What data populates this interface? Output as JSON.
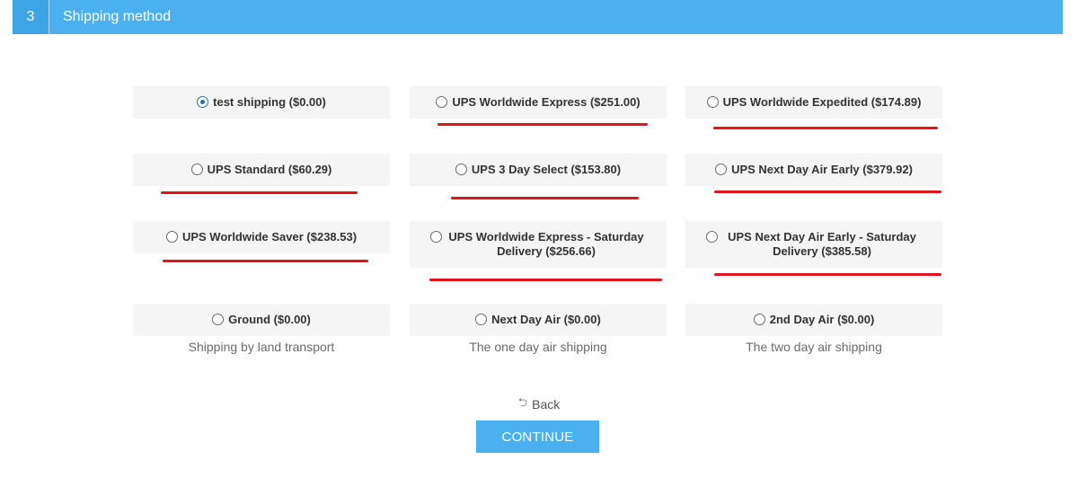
{
  "header": {
    "step_number": "3",
    "title": "Shipping method"
  },
  "options": [
    {
      "label": "test shipping ($0.00)",
      "selected": true
    },
    {
      "label": "UPS Worldwide Express ($251.00)",
      "selected": false
    },
    {
      "label": "UPS Worldwide Expedited ($174.89)",
      "selected": false
    },
    {
      "label": "UPS Standard ($60.29)",
      "selected": false
    },
    {
      "label": "UPS 3 Day Select ($153.80)",
      "selected": false
    },
    {
      "label": "UPS Next Day Air Early ($379.92)",
      "selected": false
    },
    {
      "label": "UPS Worldwide Saver ($238.53)",
      "selected": false
    },
    {
      "label": "UPS Worldwide Express - Saturday Delivery ($256.66)",
      "selected": false
    },
    {
      "label": "UPS Next Day Air Early - Saturday Delivery ($385.58)",
      "selected": false
    },
    {
      "label": "Ground ($0.00)",
      "description": "Shipping by land transport",
      "selected": false
    },
    {
      "label": "Next Day Air ($0.00)",
      "description": "The one day air shipping",
      "selected": false
    },
    {
      "label": "2nd Day Air ($0.00)",
      "description": "The two day air shipping",
      "selected": false
    }
  ],
  "navigation": {
    "back_icon": "undo-arrow-icon",
    "back_label": "Back",
    "continue_label": "CONTINUE"
  },
  "colors": {
    "accent": "#4ab0ef",
    "annotation_underline": "#e0141a",
    "radio_selected": "#1f6fc9"
  }
}
